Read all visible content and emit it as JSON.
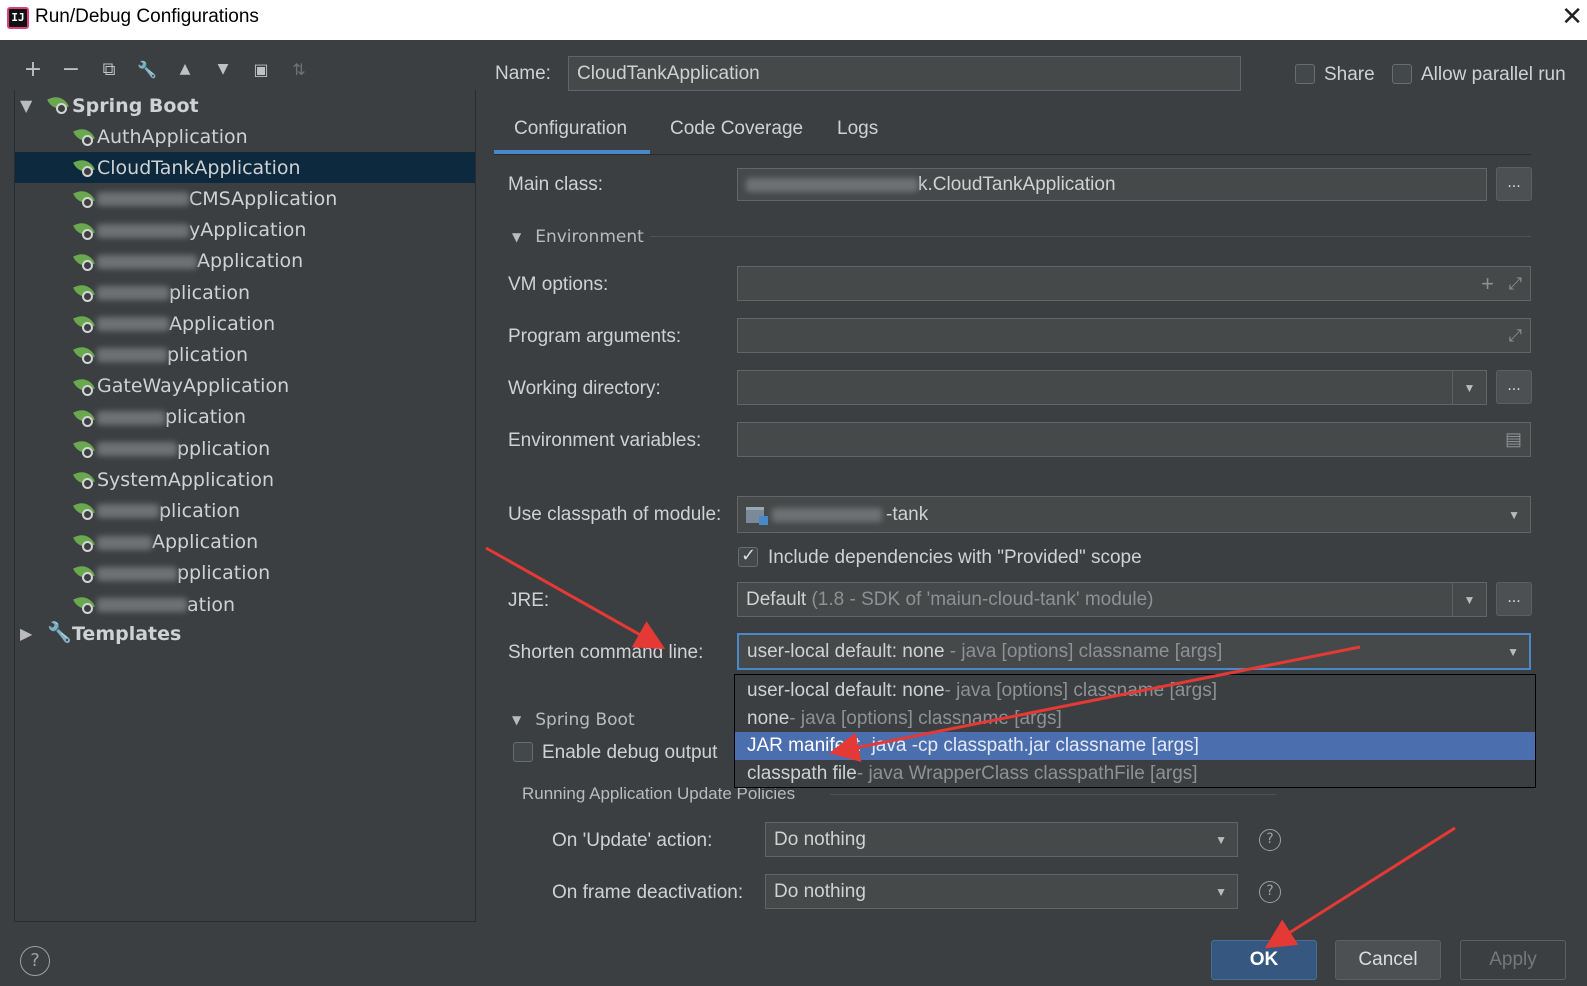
{
  "window": {
    "title": "Run/Debug Configurations",
    "close_glyph": "✕"
  },
  "toolbar": {
    "add": "+",
    "remove": "−",
    "copy": "⧉",
    "edit": "🔧",
    "up": "▲",
    "down": "▼",
    "folder": "▣",
    "sort": "⇅"
  },
  "tree": {
    "root_label": "Spring Boot",
    "items": [
      {
        "prefix": "",
        "label": "AuthApplication"
      },
      {
        "prefix": "",
        "label": "CloudTankApplication"
      },
      {
        "prefix": "",
        "label": "CMSApplication"
      },
      {
        "prefix": "",
        "label": "yApplication"
      },
      {
        "prefix": "",
        "label": "Application"
      },
      {
        "prefix": "",
        "label": "plication"
      },
      {
        "prefix": "",
        "label": "Application"
      },
      {
        "prefix": "",
        "label": "plication"
      },
      {
        "prefix": "",
        "label": "GateWayApplication"
      },
      {
        "prefix": "",
        "label": "plication"
      },
      {
        "prefix": "",
        "label": "pplication"
      },
      {
        "prefix": "",
        "label": "SystemApplication"
      },
      {
        "prefix": "",
        "label": "plication"
      },
      {
        "prefix": "",
        "label": "Application"
      },
      {
        "prefix": "",
        "label": "pplication"
      },
      {
        "prefix": "",
        "label": "ation"
      }
    ],
    "templates_label": "Templates"
  },
  "header": {
    "name_label": "Name:",
    "name_value": "CloudTankApplication",
    "share_label": "Share",
    "parallel_label": "Allow parallel run"
  },
  "tabs": {
    "configuration": "Configuration",
    "coverage": "Code Coverage",
    "logs": "Logs"
  },
  "form": {
    "main_class_label": "Main class:",
    "main_class_value": "k.CloudTankApplication",
    "environment_label": "Environment",
    "vm_options_label": "VM options:",
    "program_args_label": "Program arguments:",
    "working_dir_label": "Working directory:",
    "env_vars_label": "Environment variables:",
    "classpath_label": "Use classpath of module:",
    "classpath_value": "-tank",
    "include_deps_label": "Include dependencies with \"Provided\" scope",
    "jre_label": "JRE:",
    "jre_value": "Default",
    "jre_detail": "(1.8 - SDK of 'maiun-cloud-tank' module)",
    "shorten_label": "Shorten command line:",
    "shorten_value": "user-local default: none",
    "shorten_detail": "- java [options] classname [args]",
    "dots": "..."
  },
  "dropdown": [
    {
      "main": "user-local default: none",
      "detail": " - java [options] classname [args]"
    },
    {
      "main": "none",
      "detail": " - java [options] classname [args]"
    },
    {
      "main": "JAR manifest",
      "detail": " - java -cp classpath.jar classname [args]"
    },
    {
      "main": "classpath file",
      "detail": " - java WrapperClass classpathFile [args]"
    }
  ],
  "spring": {
    "section_label": "Spring Boot",
    "debug_label": "Enable debug output",
    "policies_label": "Running Application Update Policies",
    "update_label": "On 'Update' action:",
    "update_value": "Do nothing",
    "frame_label": "On frame deactivation:",
    "frame_value": "Do nothing"
  },
  "buttons": {
    "ok": "OK",
    "cancel": "Cancel",
    "apply": "Apply",
    "help": "?"
  },
  "colors": {
    "accent": "#4a88c7",
    "selection": "#4b6eaf",
    "ok_button": "#365880",
    "annotation_arrow": "#e53935"
  }
}
